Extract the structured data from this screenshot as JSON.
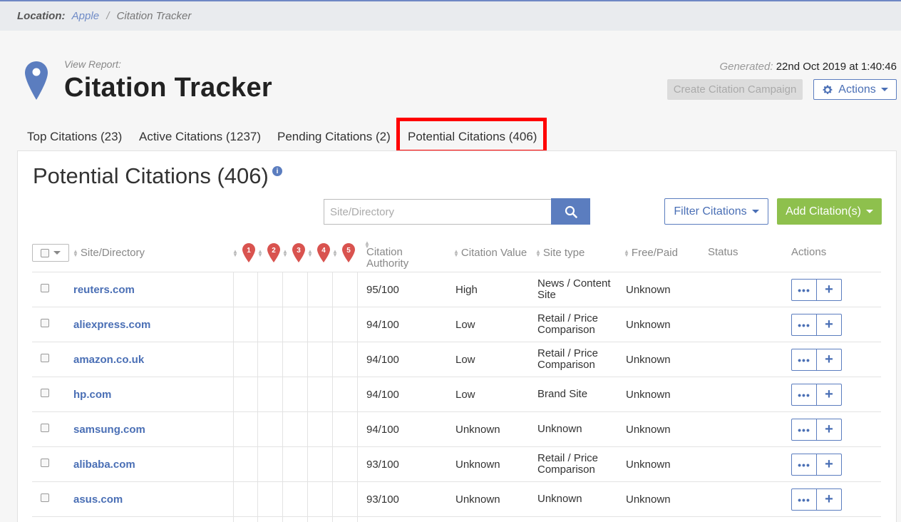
{
  "breadcrumb": {
    "label": "Location:",
    "location": "Apple",
    "separator": "/",
    "current": "Citation Tracker"
  },
  "header": {
    "view_report": "View Report:",
    "title": "Citation Tracker",
    "generated_label": "Generated:",
    "generated_value": "22nd Oct 2019 at 1:40:46"
  },
  "buttons": {
    "create_campaign": "Create Citation Campaign",
    "actions": "Actions",
    "filter": "Filter Citations",
    "add": "Add Citation(s)"
  },
  "tabs": [
    {
      "label": "Top Citations (23)"
    },
    {
      "label": "Active Citations (1237)"
    },
    {
      "label": "Pending Citations (2)"
    },
    {
      "label": "Potential Citations (406)",
      "highlighted": true
    }
  ],
  "panel": {
    "title": "Potential Citations (406)",
    "info_icon": "i"
  },
  "search": {
    "placeholder": "Site/Directory"
  },
  "table": {
    "headers": {
      "site": "Site/Directory",
      "pins": [
        "1",
        "2",
        "3",
        "4",
        "5"
      ],
      "authority": "Citation Authority",
      "value": "Citation Value",
      "site_type": "Site type",
      "free_paid": "Free/Paid",
      "status": "Status",
      "actions": "Actions"
    },
    "rows": [
      {
        "site": "reuters.com",
        "authority": "95/100",
        "value": "High",
        "site_type": "News / Content Site",
        "free_paid": "Unknown"
      },
      {
        "site": "aliexpress.com",
        "authority": "94/100",
        "value": "Low",
        "site_type": "Retail / Price Comparison",
        "free_paid": "Unknown"
      },
      {
        "site": "amazon.co.uk",
        "authority": "94/100",
        "value": "Low",
        "site_type": "Retail / Price Comparison",
        "free_paid": "Unknown"
      },
      {
        "site": "hp.com",
        "authority": "94/100",
        "value": "Low",
        "site_type": "Brand Site",
        "free_paid": "Unknown"
      },
      {
        "site": "samsung.com",
        "authority": "94/100",
        "value": "Unknown",
        "site_type": "Unknown",
        "free_paid": "Unknown"
      },
      {
        "site": "alibaba.com",
        "authority": "93/100",
        "value": "Unknown",
        "site_type": "Retail / Price Comparison",
        "free_paid": "Unknown"
      },
      {
        "site": "asus.com",
        "authority": "93/100",
        "value": "Unknown",
        "site_type": "Unknown",
        "free_paid": "Unknown"
      }
    ],
    "row_actions": {
      "more": "•••",
      "add": "+"
    }
  },
  "colors": {
    "accent": "#5b7dbf",
    "add_button": "#8ec04d",
    "pin_red": "#d9534f",
    "highlight": "#ff0000"
  }
}
